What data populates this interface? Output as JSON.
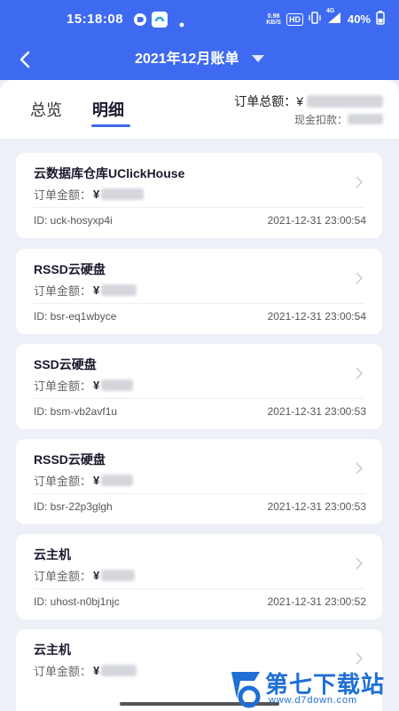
{
  "status_bar": {
    "time": "15:18:08",
    "net_speed_value": "0.98",
    "net_speed_unit": "KB/S",
    "hd_badge": "HD",
    "signal": "4G",
    "battery": "40%"
  },
  "navbar": {
    "title": "2021年12月账单"
  },
  "tabs": [
    {
      "label": "总览",
      "active": false
    },
    {
      "label": "明细",
      "active": true
    }
  ],
  "summary": {
    "total_label": "订单总额：¥",
    "cash_label": "现金扣款："
  },
  "orders": [
    {
      "name": "云数据库仓库UClickHouse",
      "amount_label": "订单金额：",
      "currency": "¥",
      "id": "ID: uck-hosyxp4i",
      "date": "2021-12-31 23:00:54"
    },
    {
      "name": "RSSD云硬盘",
      "amount_label": "订单金额：",
      "currency": "¥",
      "id": "ID: bsr-eq1wbyce",
      "date": "2021-12-31 23:00:54"
    },
    {
      "name": "SSD云硬盘",
      "amount_label": "订单金额：",
      "currency": "¥",
      "id": "ID: bsm-vb2avf1u",
      "date": "2021-12-31 23:00:53"
    },
    {
      "name": "RSSD云硬盘",
      "amount_label": "订单金额：",
      "currency": "¥",
      "id": "ID: bsr-22p3glgh",
      "date": "2021-12-31 23:00:53"
    },
    {
      "name": "云主机",
      "amount_label": "订单金额：",
      "currency": "¥",
      "id": "ID: uhost-n0bj1njc",
      "date": "2021-12-31 23:00:52"
    },
    {
      "name": "云主机",
      "amount_label": "订单金额：",
      "currency": "¥",
      "id": "",
      "date": ""
    }
  ],
  "watermark": {
    "text": "第七下载站",
    "url": "www.d7down.com"
  },
  "colors": {
    "brand": "#3d6af0",
    "background": "#eef0f8",
    "watermark": "#1f6fd6"
  }
}
